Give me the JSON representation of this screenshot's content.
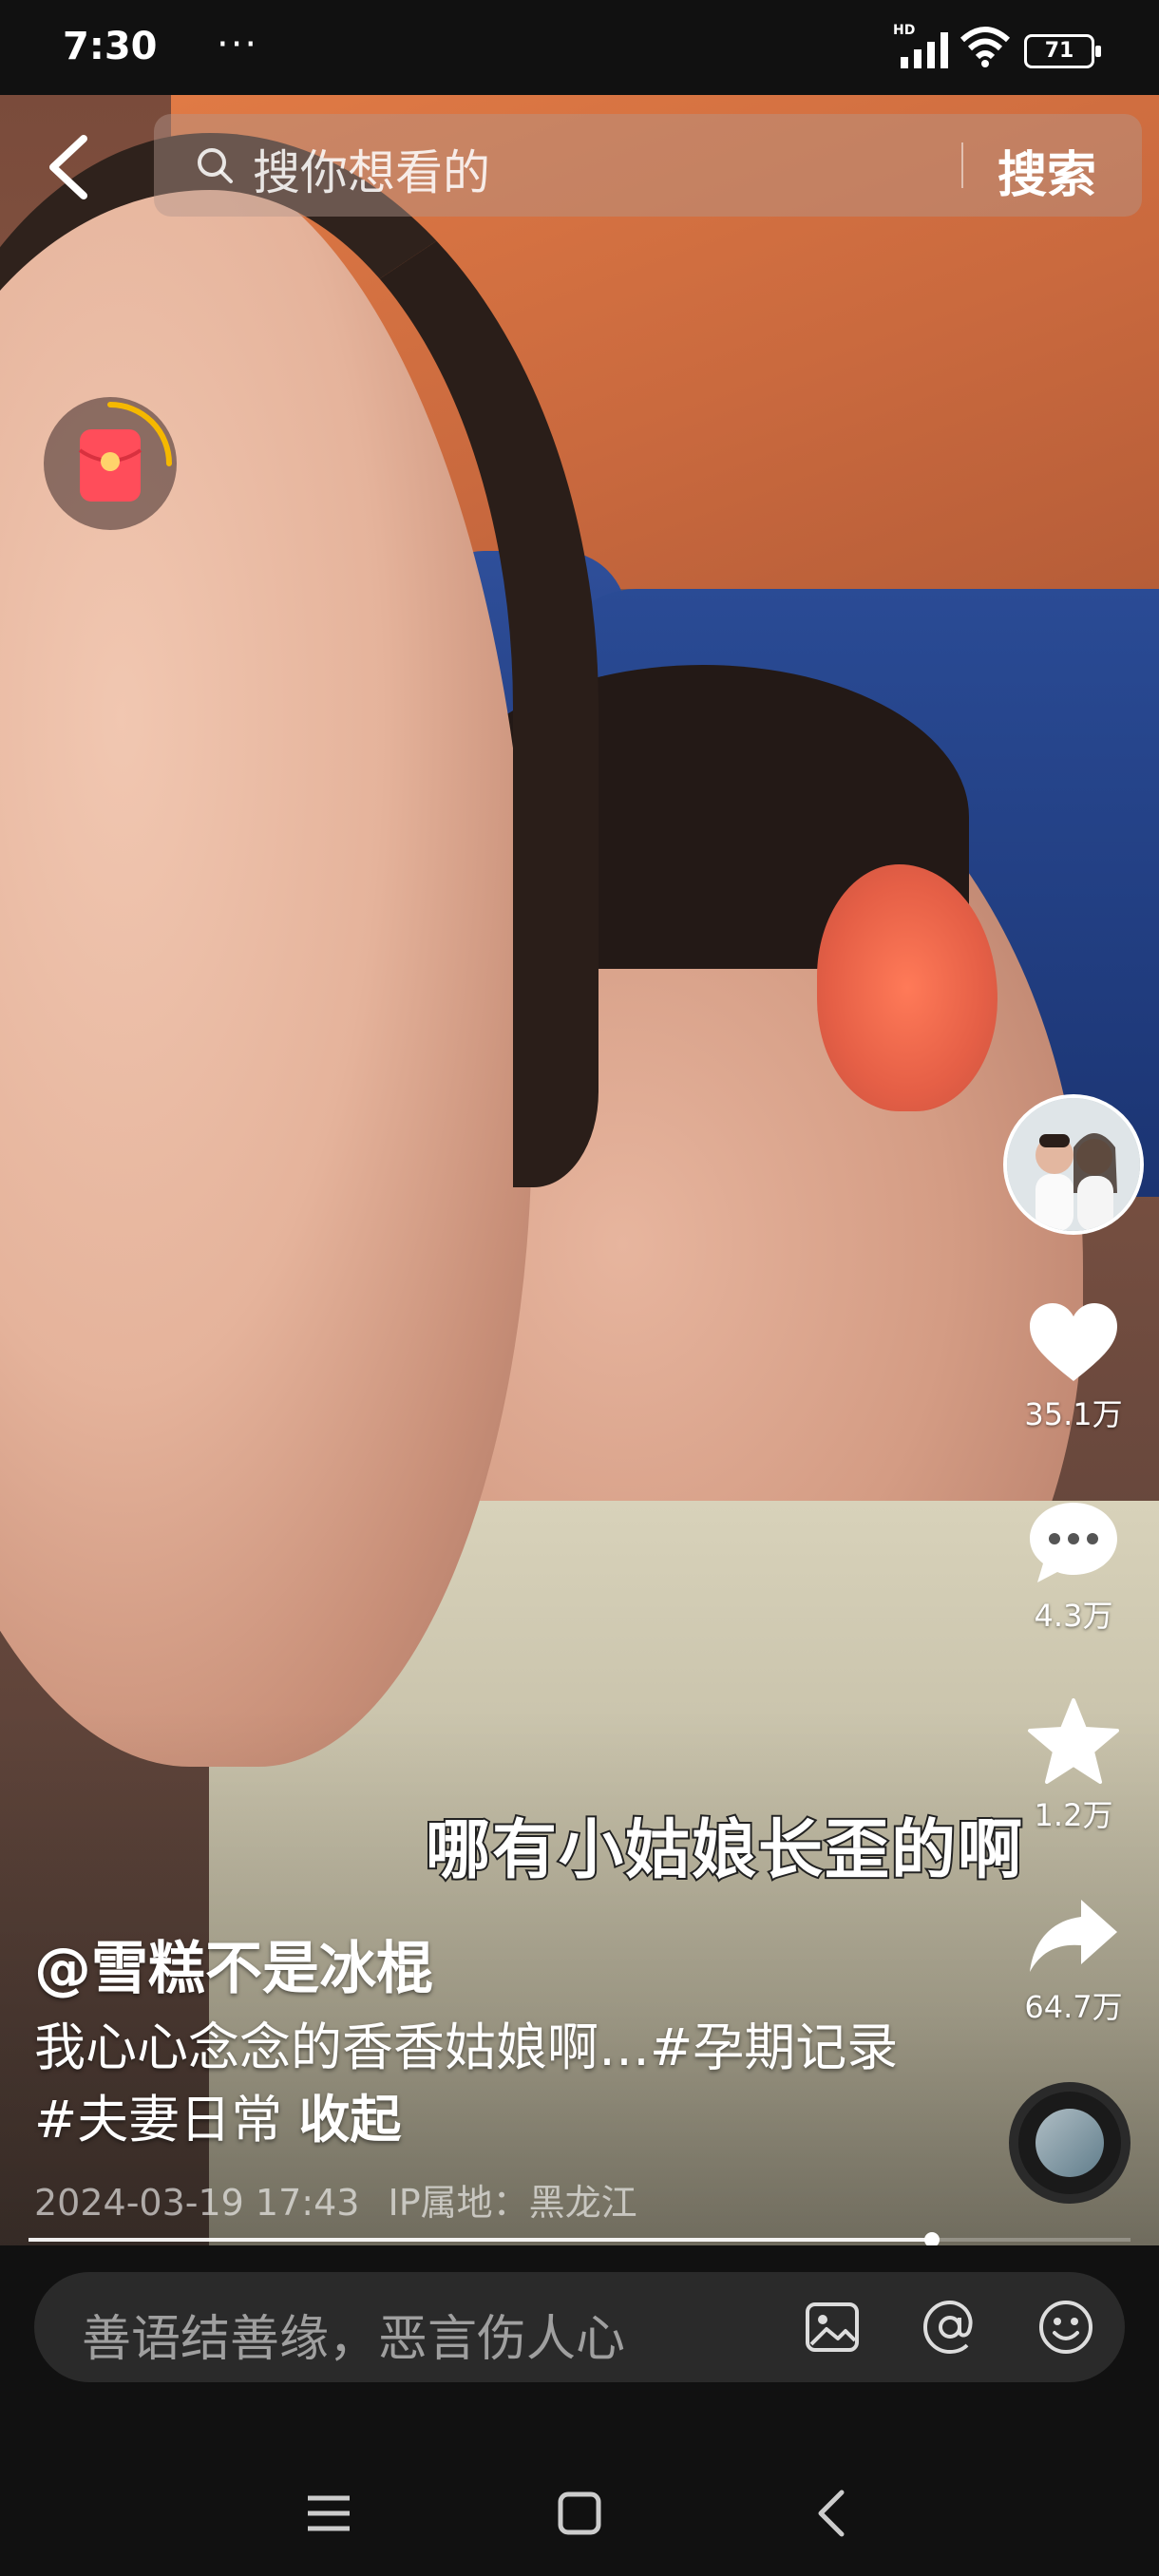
{
  "status_bar": {
    "time": "7:30",
    "dots": "···",
    "network": "HD",
    "battery": "71"
  },
  "search": {
    "placeholder": "搜你想看的",
    "button": "搜索"
  },
  "actions": {
    "like_count": "35.1万",
    "comment_count": "4.3万",
    "favorite_count": "1.2万",
    "share_count": "64.7万"
  },
  "video": {
    "subtitle": "哪有小姑娘长歪的啊",
    "author": "@雪糕不是冰棍",
    "caption_text": "我心心念念的香香姑娘啊…#孕期记录 #夫妻日常 ",
    "collapse": "收起",
    "date": "2024-03-19 17:43",
    "ip_location": "IP属地：黑龙江",
    "progress": 0.82
  },
  "comment": {
    "placeholder": "善语结善缘，恶言伤人心"
  },
  "icons": {
    "back": "chevron-left-icon",
    "search": "magnifier-icon",
    "red_packet": "red-packet-icon",
    "like": "heart-icon",
    "comment": "speech-bubble-icon",
    "favorite": "star-icon",
    "share": "share-arrow-icon",
    "image": "image-icon",
    "mention": "at-icon",
    "emoji": "smile-icon",
    "nav_menu": "menu-icon",
    "nav_home": "square-icon",
    "nav_back": "back-triangle-icon"
  }
}
